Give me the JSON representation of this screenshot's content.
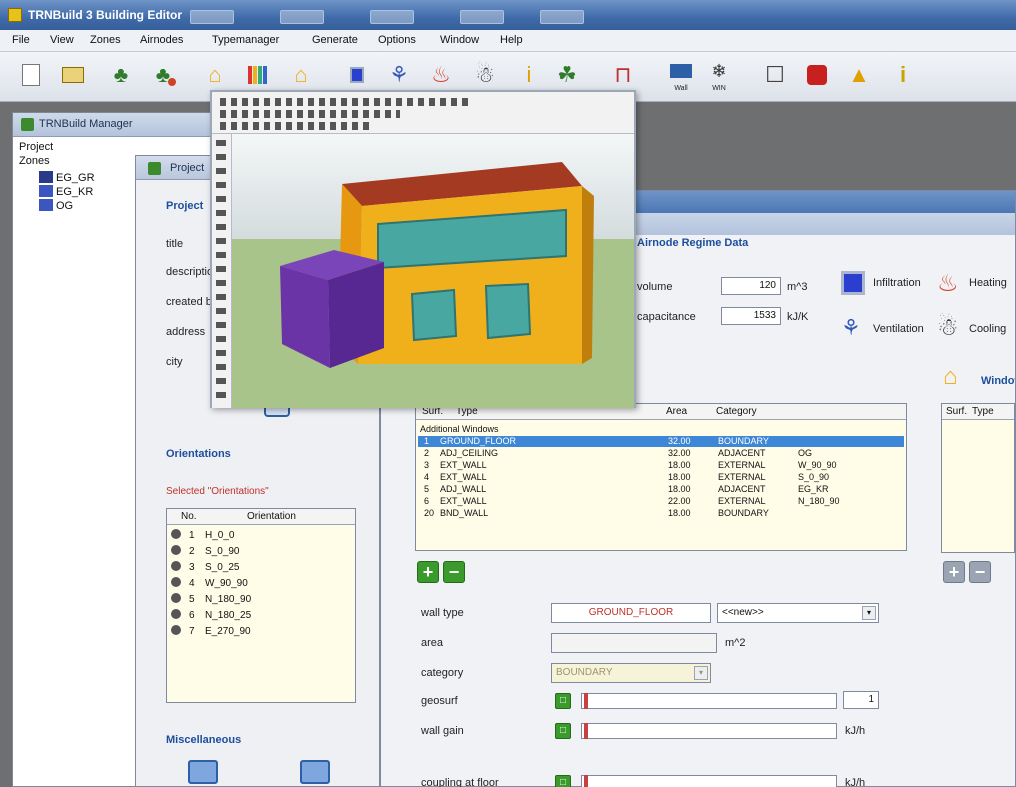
{
  "app": {
    "title": "TRNBuild 3 Building Editor",
    "menu": [
      "File",
      "View",
      "Zones",
      "Airnodes",
      "Typemanager",
      "Generate",
      "Options",
      "Window",
      "Help"
    ]
  },
  "toolbar": {
    "buttons": [
      {
        "icon": "new-file-icon"
      },
      {
        "icon": "open-file-icon"
      },
      {
        "icon": "tree-green-icon"
      },
      {
        "icon": "tree-red-icon"
      },
      {
        "icon": "house-yellow-icon"
      },
      {
        "icon": "bars-colored-icon"
      },
      {
        "icon": "house-outline-icon"
      },
      {
        "icon": "infiltration-icon"
      },
      {
        "icon": "ventilation-icon"
      },
      {
        "icon": "heating-icon"
      },
      {
        "icon": "cooling-icon"
      },
      {
        "icon": "gains-icon"
      },
      {
        "icon": "comfort-icon"
      },
      {
        "icon": "schedule-icon"
      },
      {
        "icon": "wall-type-icon",
        "caption": "Wall"
      },
      {
        "icon": "window-type-icon",
        "caption": "WIN"
      },
      {
        "icon": "lock-icon"
      },
      {
        "icon": "red-cube-icon"
      },
      {
        "icon": "triangle-icon"
      },
      {
        "icon": "info-icon"
      }
    ]
  },
  "manager": {
    "title": "TRNBuild Manager",
    "tree": {
      "project": "Project",
      "zones": "Zones",
      "items": [
        "EG_GR",
        "EG_KR",
        "OG"
      ]
    }
  },
  "project_window": {
    "title": "Project",
    "section_project": "Project",
    "fields": [
      "title",
      "description",
      "created by",
      "address",
      "city"
    ],
    "section_orientations": "Orientations",
    "selected_label": "Selected \"Orientations\"",
    "orient_columns": [
      "No.",
      "Orientation"
    ],
    "orientations": [
      {
        "no": "1",
        "name": "H_0_0"
      },
      {
        "no": "2",
        "name": "S_0_90"
      },
      {
        "no": "3",
        "name": "S_0_25"
      },
      {
        "no": "4",
        "name": "W_90_90"
      },
      {
        "no": "5",
        "name": "N_180_90"
      },
      {
        "no": "6",
        "name": "N_180_25"
      },
      {
        "no": "7",
        "name": "E_270_90"
      }
    ],
    "section_misc": "Miscellaneous"
  },
  "zone_window": {
    "header": "Airnode Regime Data",
    "volume_label": "volume",
    "volume_value": "120",
    "volume_unit": "m^3",
    "capacitance_label": "capacitance",
    "capacitance_value": "1533",
    "capacitance_unit": "kJ/K",
    "features": [
      "Infiltration",
      "Heating",
      "Ventilation",
      "Cooling"
    ],
    "windows_label": "Window",
    "walls_columns": [
      "Surf.",
      "Type",
      "Area",
      "Category"
    ],
    "walls_section": "Additional Windows",
    "walls": [
      {
        "surf": "1",
        "type": "GROUND_FLOOR",
        "area": "32.00",
        "category": "BOUNDARY",
        "extra": ""
      },
      {
        "surf": "2",
        "type": "ADJ_CEILING",
        "area": "32.00",
        "category": "ADJACENT",
        "extra": "OG"
      },
      {
        "surf": "3",
        "type": "EXT_WALL",
        "area": "18.00",
        "category": "EXTERNAL",
        "extra": "W_90_90"
      },
      {
        "surf": "4",
        "type": "EXT_WALL",
        "area": "18.00",
        "category": "EXTERNAL",
        "extra": "S_0_90"
      },
      {
        "surf": "5",
        "type": "ADJ_WALL",
        "area": "18.00",
        "category": "ADJACENT",
        "extra": "EG_KR"
      },
      {
        "surf": "6",
        "type": "EXT_WALL",
        "area": "22.00",
        "category": "EXTERNAL",
        "extra": "N_180_90"
      },
      {
        "surf": "20",
        "type": "BND_WALL",
        "area": "18.00",
        "category": "BOUNDARY",
        "extra": ""
      }
    ],
    "right_columns": [
      "Surf.",
      "Type"
    ],
    "form": {
      "wall_type_label": "wall type",
      "wall_type_value": "GROUND_FLOOR",
      "new_option": "<<new>>",
      "area_label": "area",
      "area_unit": "m^2",
      "category_label": "category",
      "category_value": "BOUNDARY",
      "geosurf_label": "geosurf",
      "geosurf_value": "1",
      "wall_gain_label": "wall gain",
      "wall_gain_unit": "kJ/h",
      "coupling_label": "coupling at floor",
      "coupling_unit": "kJ/h"
    }
  },
  "colors": {
    "title_bar": "#3f6ba8",
    "selection": "#3e86d6",
    "accent_green": "#3a9a2c",
    "house_orange": "#f0b01c",
    "roof_red": "#a53a22",
    "annex_purple": "#6a33a6",
    "window_teal": "#49a7a2"
  }
}
